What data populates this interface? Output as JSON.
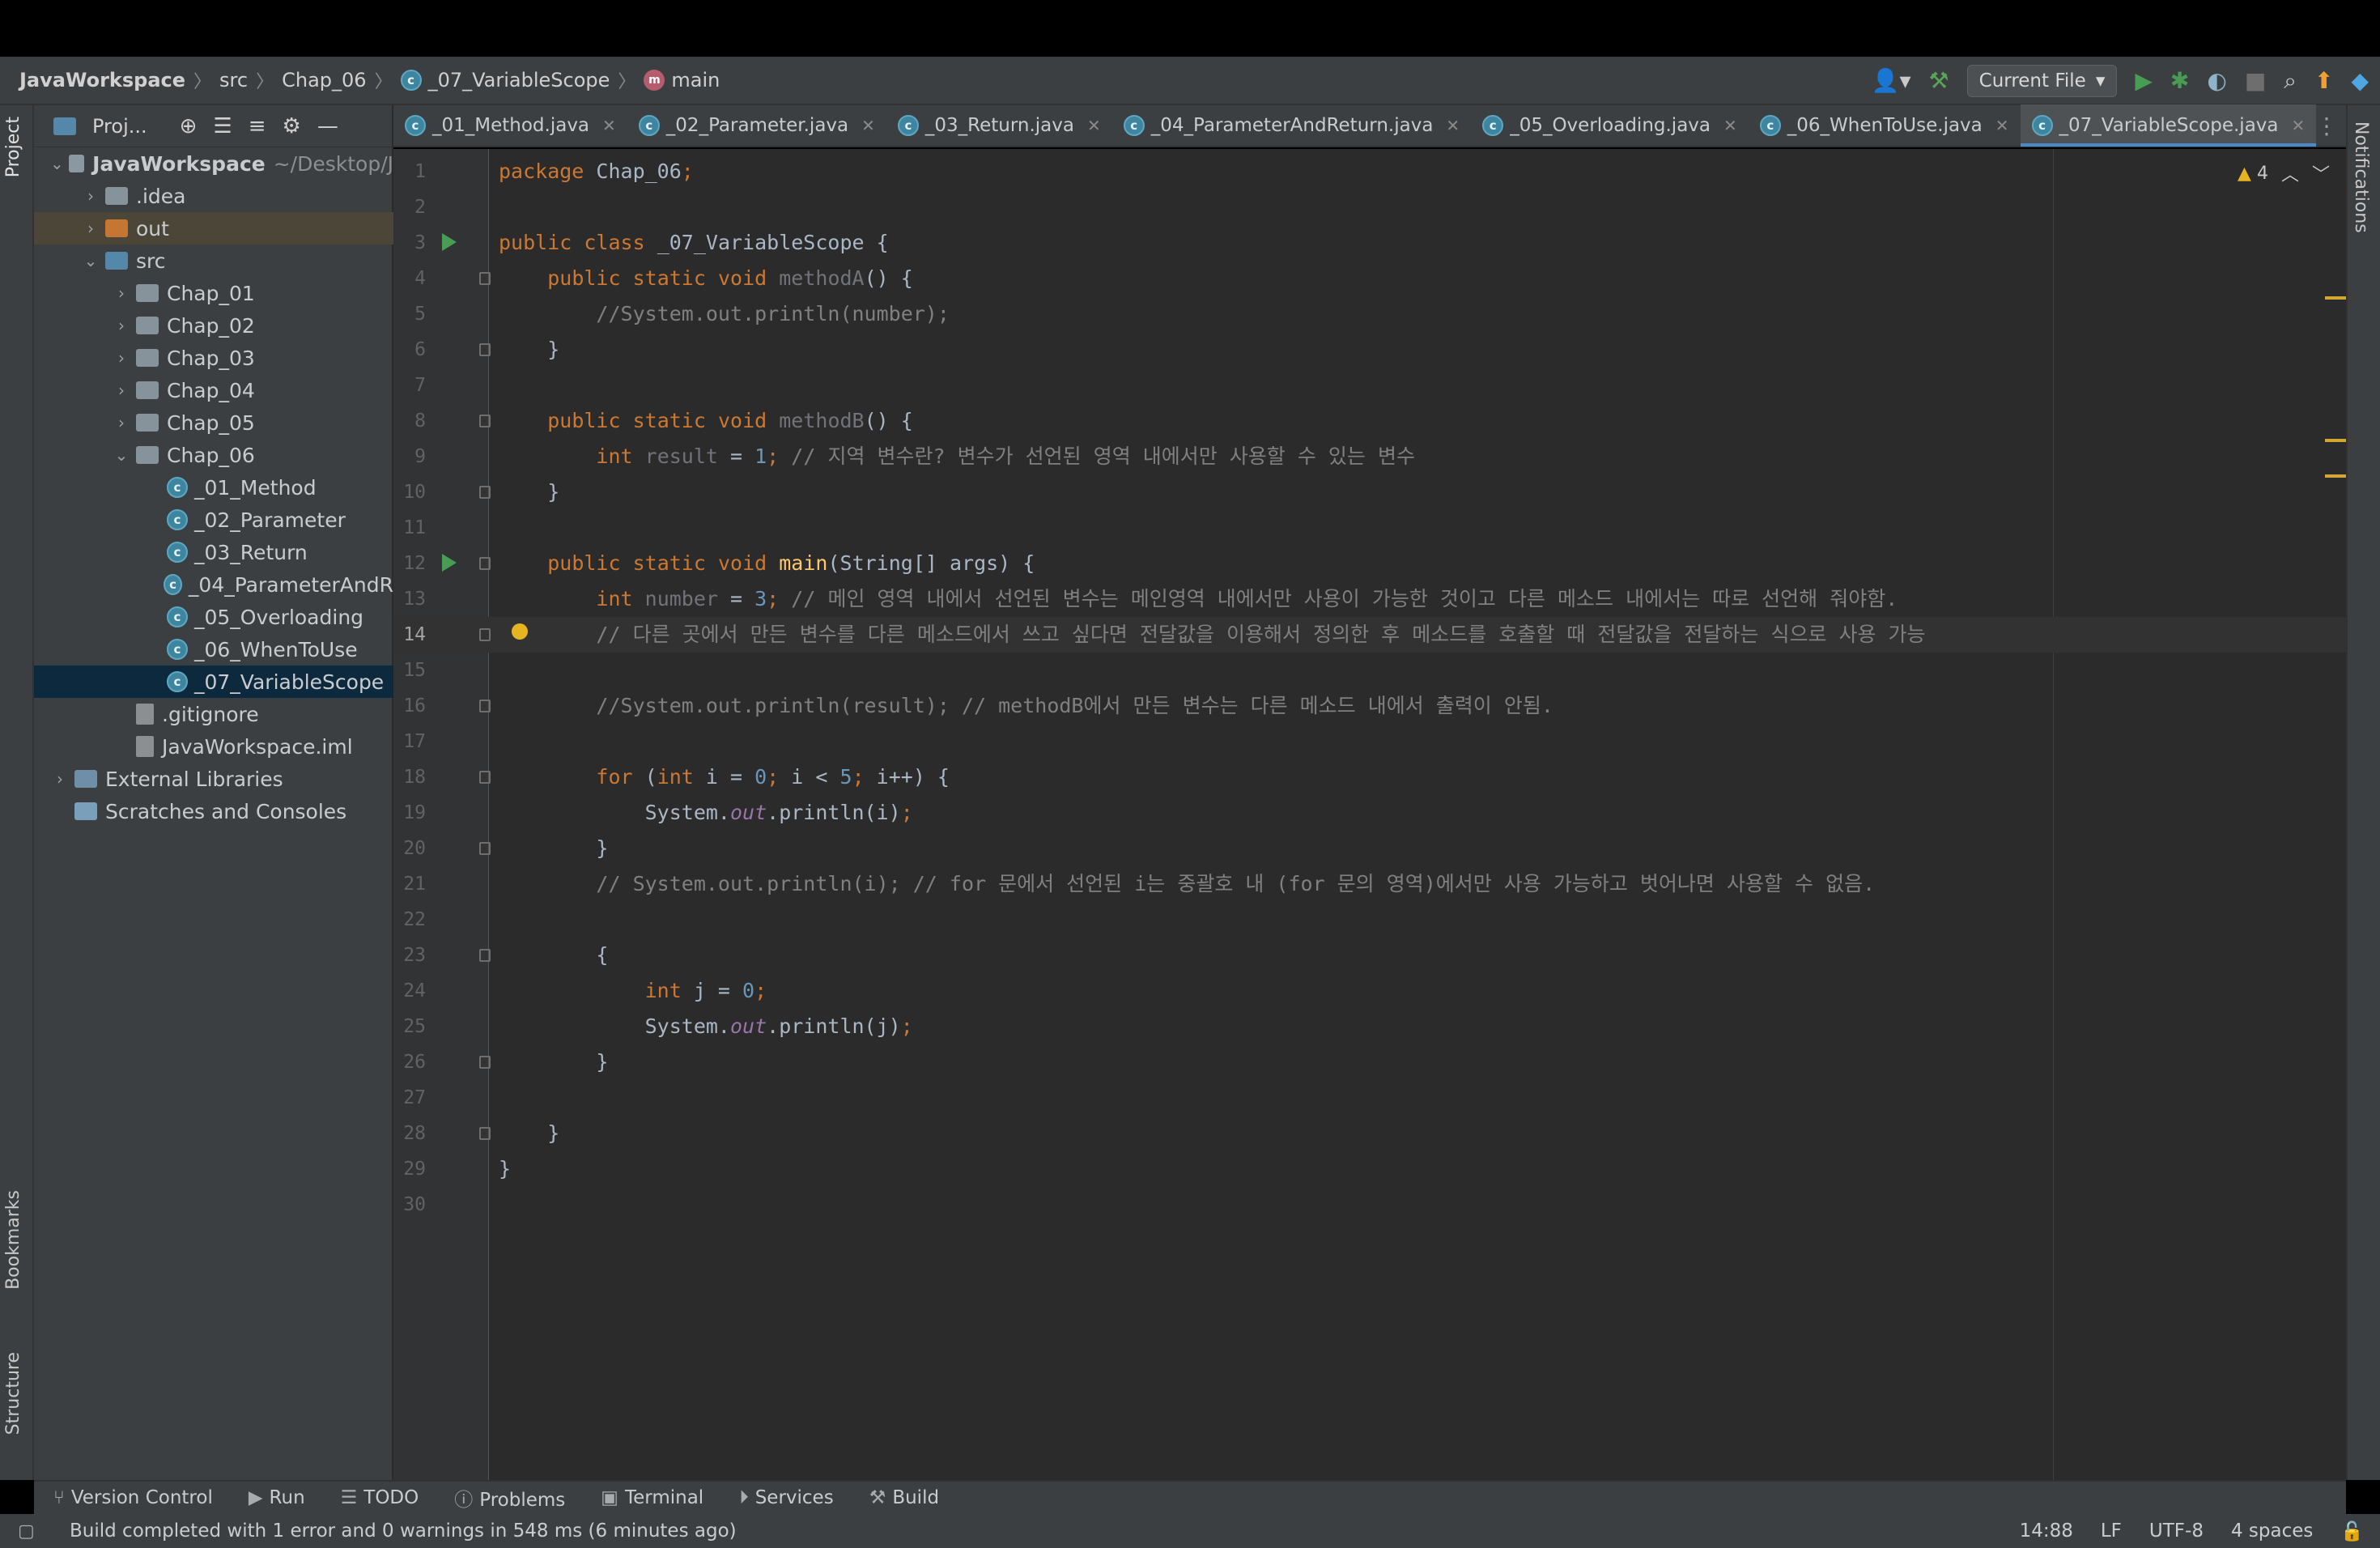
{
  "breadcrumb": [
    "JavaWorkspace",
    "src",
    "Chap_06",
    "_07_VariableScope",
    "main"
  ],
  "run_config": "Current File",
  "project_panel": {
    "title": "Proj...",
    "tree": [
      {
        "label": "JavaWorkspace",
        "hint": "~/Desktop/J",
        "depth": 0,
        "kind": "module",
        "expanded": true
      },
      {
        "label": ".idea",
        "depth": 1,
        "kind": "folder"
      },
      {
        "label": "out",
        "depth": 1,
        "kind": "folder-orange"
      },
      {
        "label": "src",
        "depth": 1,
        "kind": "folder-blue",
        "expanded": true
      },
      {
        "label": "Chap_01",
        "depth": 2,
        "kind": "package"
      },
      {
        "label": "Chap_02",
        "depth": 2,
        "kind": "package"
      },
      {
        "label": "Chap_03",
        "depth": 2,
        "kind": "package"
      },
      {
        "label": "Chap_04",
        "depth": 2,
        "kind": "package"
      },
      {
        "label": "Chap_05",
        "depth": 2,
        "kind": "package"
      },
      {
        "label": "Chap_06",
        "depth": 2,
        "kind": "package",
        "expanded": true
      },
      {
        "label": "_01_Method",
        "depth": 3,
        "kind": "class"
      },
      {
        "label": "_02_Parameter",
        "depth": 3,
        "kind": "class"
      },
      {
        "label": "_03_Return",
        "depth": 3,
        "kind": "class"
      },
      {
        "label": "_04_ParameterAndR",
        "depth": 3,
        "kind": "class"
      },
      {
        "label": "_05_Overloading",
        "depth": 3,
        "kind": "class"
      },
      {
        "label": "_06_WhenToUse",
        "depth": 3,
        "kind": "class"
      },
      {
        "label": "_07_VariableScope",
        "depth": 3,
        "kind": "class",
        "selected": true
      },
      {
        "label": ".gitignore",
        "depth": 2,
        "kind": "file"
      },
      {
        "label": "JavaWorkspace.iml",
        "depth": 2,
        "kind": "file"
      },
      {
        "label": "External Libraries",
        "depth": 0,
        "kind": "library"
      },
      {
        "label": "Scratches and Consoles",
        "depth": 0,
        "kind": "scratch"
      }
    ]
  },
  "tabs": [
    {
      "label": "_01_Method.java"
    },
    {
      "label": "_02_Parameter.java"
    },
    {
      "label": "_03_Return.java"
    },
    {
      "label": "_04_ParameterAndReturn.java"
    },
    {
      "label": "_05_Overloading.java"
    },
    {
      "label": "_06_WhenToUse.java"
    },
    {
      "label": "_07_VariableScope.java",
      "active": true
    }
  ],
  "warnings_count": "4",
  "code_lines": [
    "package Chap_06;",
    "",
    "public class _07_VariableScope {",
    "    public static void methodA() {",
    "        //System.out.println(number);",
    "    }",
    "",
    "    public static void methodB() {",
    "        int result = 1; // 지역 변수란? 변수가 선언된 영역 내에서만 사용할 수 있는 변수",
    "    }",
    "",
    "    public static void main(String[] args) {",
    "        int number = 3; // 메인 영역 내에서 선언된 변수는 메인영역 내에서만 사용이 가능한 것이고 다른 메소드 내에서는 따로 선언해 줘야함.",
    "        // 다른 곳에서 만든 변수를 다른 메소드에서 쓰고 싶다면 전달값을 이용해서 정의한 후 메소드를 호출할 때 전달값을 전달하는 식으로 사용 가능",
    "",
    "        //System.out.println(result); // methodB에서 만든 변수는 다른 메소드 내에서 출력이 안됨.",
    "",
    "        for (int i = 0; i < 5; i++) {",
    "            System.out.println(i);",
    "        }",
    "        // System.out.println(i); // for 문에서 선언된 i는 중괄호 내 (for 문의 영역)에서만 사용 가능하고 벗어나면 사용할 수 없음.",
    "",
    "        {",
    "            int j = 0;",
    "            System.out.println(j);",
    "        }",
    "",
    "    }",
    "}",
    ""
  ],
  "left_tool_tabs": [
    "Project",
    "Bookmarks",
    "Structure"
  ],
  "right_tool_tabs": [
    "Notifications"
  ],
  "bottom_toolbar": [
    "Version Control",
    "Run",
    "TODO",
    "Problems",
    "Terminal",
    "Services",
    "Build"
  ],
  "status": {
    "message": "Build completed with 1 error and 0 warnings in 548 ms (6 minutes ago)",
    "position": "14:88",
    "line_sep": "LF",
    "encoding": "UTF-8",
    "indent": "4 spaces"
  },
  "colors": {
    "keyword": "#cc7832",
    "function": "#ffc66d",
    "number": "#6897bb",
    "comment": "#808080",
    "static_field": "#9876aa",
    "selection": "#0d293e",
    "accent": "#4a88c7"
  }
}
